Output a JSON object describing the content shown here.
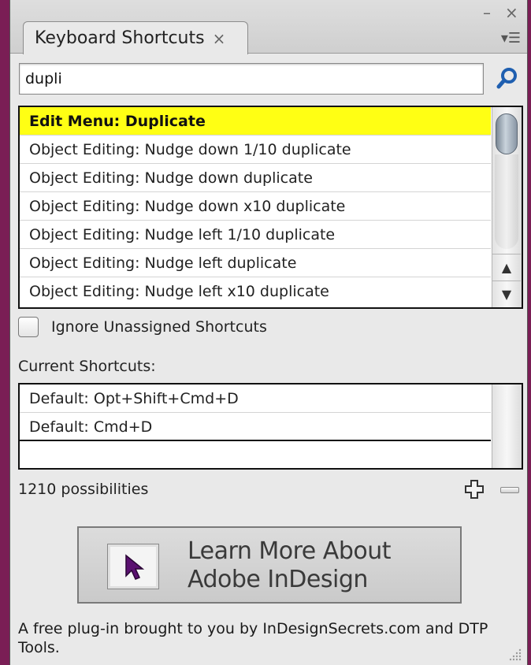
{
  "panel": {
    "tab_label": "Keyboard Shortcuts",
    "tab_close": "×",
    "window_minimize": "–",
    "window_close": "×",
    "menu_glyph": "▾☰"
  },
  "search": {
    "value": "dupli",
    "placeholder": ""
  },
  "results": {
    "items": [
      "Edit Menu: Duplicate",
      "Object Editing: Nudge down 1/10 duplicate",
      "Object Editing: Nudge down duplicate",
      "Object Editing: Nudge down x10 duplicate",
      "Object Editing: Nudge left 1/10 duplicate",
      "Object Editing: Nudge left duplicate",
      "Object Editing: Nudge left x10 duplicate"
    ],
    "selected_index": 0,
    "scroll_up": "▲",
    "scroll_down": "▼"
  },
  "ignore_unassigned": {
    "label": "Ignore Unassigned Shortcuts",
    "checked": false
  },
  "current_shortcuts": {
    "label": "Current Shortcuts:",
    "items": [
      "Default: Opt+Shift+Cmd+D",
      "Default: Cmd+D"
    ]
  },
  "status": {
    "count_text": "1210 possibilities"
  },
  "learn_more": {
    "line1": "Learn More About",
    "line2": "Adobe InDesign"
  },
  "footer": {
    "text": "A free plug-in brought to you by InDesignSecrets.com and DTP Tools."
  },
  "colors": {
    "selected_row": "#ffff14",
    "desktop_bg": "#7a1e55",
    "search_icon": "#1f5fb0",
    "cursor_icon": "#5a1070"
  },
  "icons": {
    "search": "search-icon",
    "add": "plus-icon",
    "remove": "minus-icon",
    "cursor": "cursor-arrow-icon",
    "grip": "resize-grip-icon"
  }
}
